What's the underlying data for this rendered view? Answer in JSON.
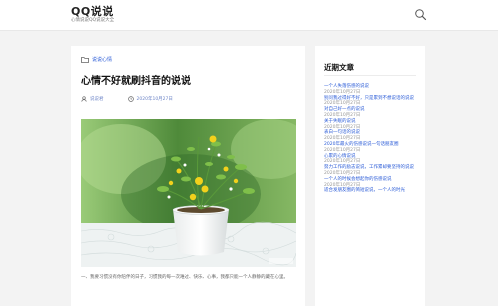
{
  "header": {
    "site_title": "QQ说说",
    "site_desc": "心情说说QQ说说大全"
  },
  "post": {
    "category": "说说心情",
    "title": "心情不好就刷抖音的说说",
    "author": "说说君",
    "date": "2020年10月27日",
    "excerpt": "一、我要习惯没有你陪伴的日子，习惯我的每一次难过、快乐、心事，我都只能一个人静静的藏在心里。"
  },
  "sidebar": {
    "title": "近期文章",
    "recent_posts": [
      {
        "title": "一个人失落伤感的说说",
        "date": "2020年10月27日"
      },
      {
        "title": "别问我过得好不好，只是累到不想说话的说说",
        "date": "2020年10月27日"
      },
      {
        "title": "对自己好一点的说说",
        "date": "2020年10月27日"
      },
      {
        "title": "关于失眠的说说",
        "date": "2020年10月27日"
      },
      {
        "title": "表白一句话的说说",
        "date": "2020年10月27日"
      },
      {
        "title": "2020年最火的伤感说说一句话朋友圈",
        "date": "2020年10月27日"
      },
      {
        "title": "心累的心情说说",
        "date": "2020年10月27日"
      },
      {
        "title": "努力工作的励志说说，工作累却要坚持的说说",
        "date": "2020年10月27日"
      },
      {
        "title": "一个人的时候会想起你的伤感说说",
        "date": "2020年10月27日"
      },
      {
        "title": "适合发朋友圈的简短说说，一个人的时光",
        "date": ""
      }
    ]
  }
}
